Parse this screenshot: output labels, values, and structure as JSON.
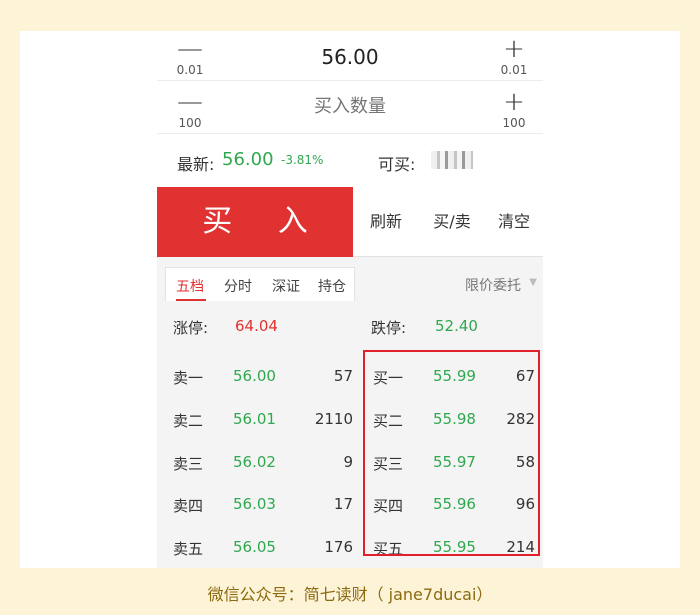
{
  "price_stepper": {
    "minus_label": "0.01",
    "value": "56.00",
    "plus_label": "0.01"
  },
  "quantity_stepper": {
    "minus_label": "100",
    "placeholder": "买入数量",
    "plus_label": "100"
  },
  "quote": {
    "latest_label": "最新:",
    "latest_value": "56.00",
    "change_pct": "-3.81%",
    "available_label": "可买:"
  },
  "actions": {
    "buy": "买 入",
    "refresh": "刷新",
    "buy_sell": "买/卖",
    "clear": "清空"
  },
  "tabs": [
    "五档",
    "分时",
    "深证",
    "持仓"
  ],
  "order_type": "限价委托",
  "limits": {
    "limit_up_label": "涨停:",
    "limit_up_value": "64.04",
    "limit_down_label": "跌停:",
    "limit_down_value": "52.40"
  },
  "sell_levels": [
    {
      "label": "卖一",
      "price": "56.00",
      "qty": "57"
    },
    {
      "label": "卖二",
      "price": "56.01",
      "qty": "2110"
    },
    {
      "label": "卖三",
      "price": "56.02",
      "qty": "9"
    },
    {
      "label": "卖四",
      "price": "56.03",
      "qty": "17"
    },
    {
      "label": "卖五",
      "price": "56.05",
      "qty": "176"
    }
  ],
  "buy_levels": [
    {
      "label": "买一",
      "price": "55.99",
      "qty": "67"
    },
    {
      "label": "买二",
      "price": "55.98",
      "qty": "282"
    },
    {
      "label": "买三",
      "price": "55.97",
      "qty": "58"
    },
    {
      "label": "买四",
      "price": "55.96",
      "qty": "96"
    },
    {
      "label": "买五",
      "price": "55.95",
      "qty": "214"
    }
  ],
  "caption": "微信公众号：简七读财（ jane7ducai）",
  "colors": {
    "buy_red": "#e13232",
    "price_green": "#2fa84f",
    "highlight": "#e0202a"
  }
}
